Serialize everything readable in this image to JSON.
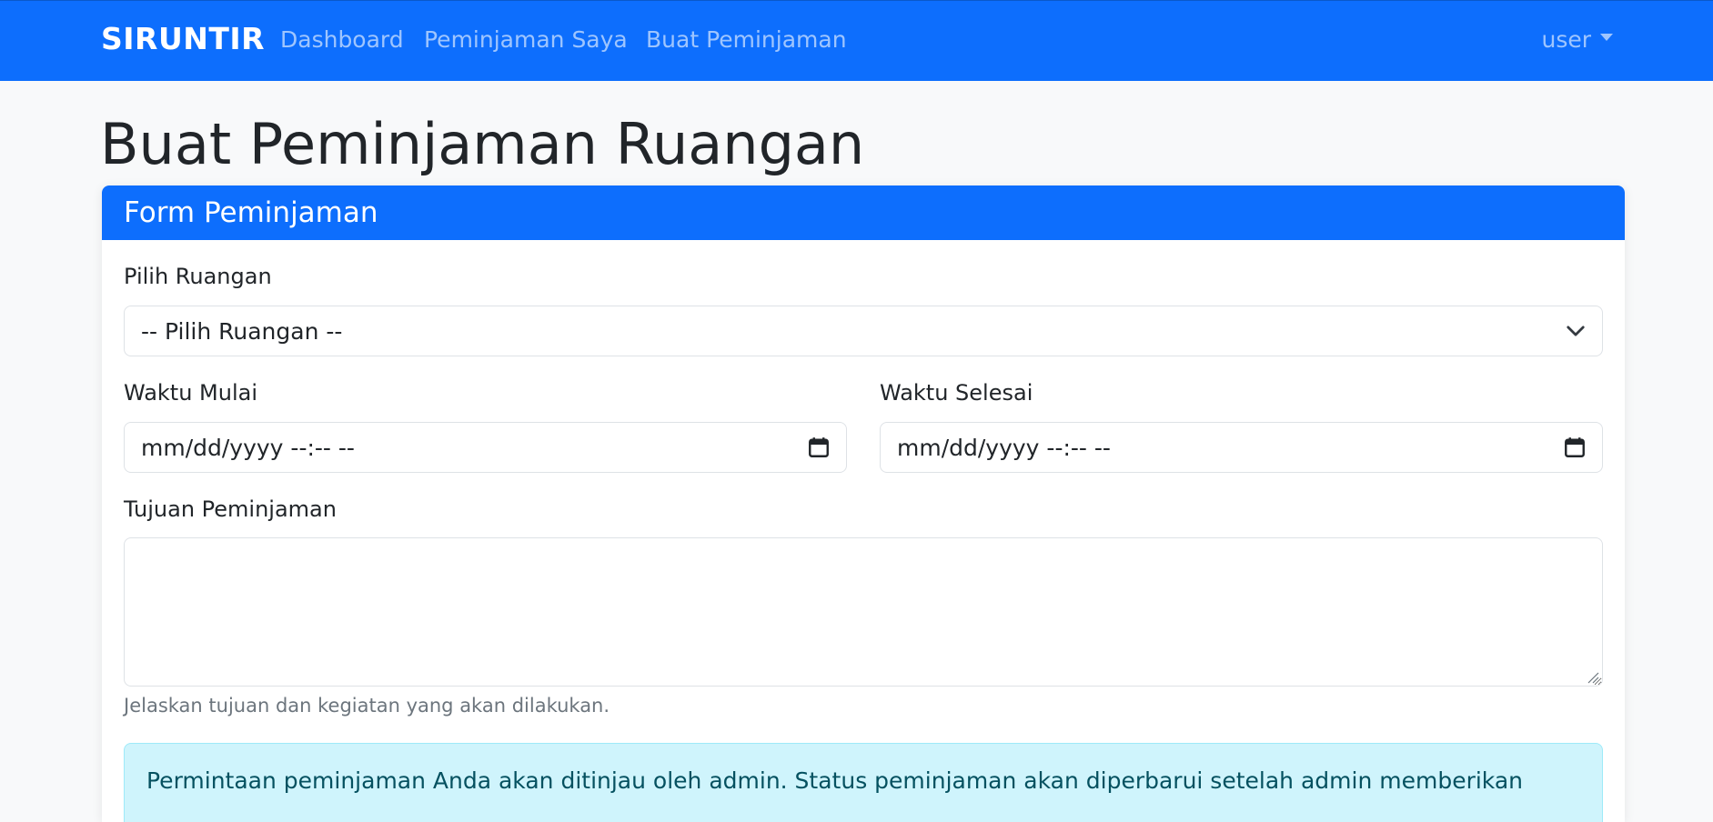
{
  "navbar": {
    "brand": "SIRUNTIR",
    "links": [
      "Dashboard",
      "Peminjaman Saya",
      "Buat Peminjaman"
    ],
    "user_label": "user",
    "user_menu_icon": "caret-down-icon"
  },
  "page": {
    "title": "Buat Peminjaman Ruangan"
  },
  "form": {
    "header": "Form Peminjaman",
    "room": {
      "label": "Pilih Ruangan",
      "selected": "-- Pilih Ruangan --",
      "icon": "chevron-down-icon"
    },
    "start": {
      "label": "Waktu Mulai",
      "value": "mm/dd/yyyy --:-- --",
      "icon": "calendar-icon"
    },
    "end": {
      "label": "Waktu Selesai",
      "value": "mm/dd/yyyy --:-- --",
      "icon": "calendar-icon"
    },
    "purpose": {
      "label": "Tujuan Peminjaman",
      "value": "",
      "help": "Jelaskan tujuan dan kegiatan yang akan dilakukan."
    },
    "notice": "Permintaan peminjaman Anda akan ditinjau oleh admin. Status peminjaman akan diperbarui setelah admin memberikan"
  },
  "colors": {
    "primary": "#0d6efd",
    "background": "#f8f9fa",
    "alert_bg": "#cff4fc",
    "alert_text": "#055160",
    "muted": "#6c757d"
  }
}
